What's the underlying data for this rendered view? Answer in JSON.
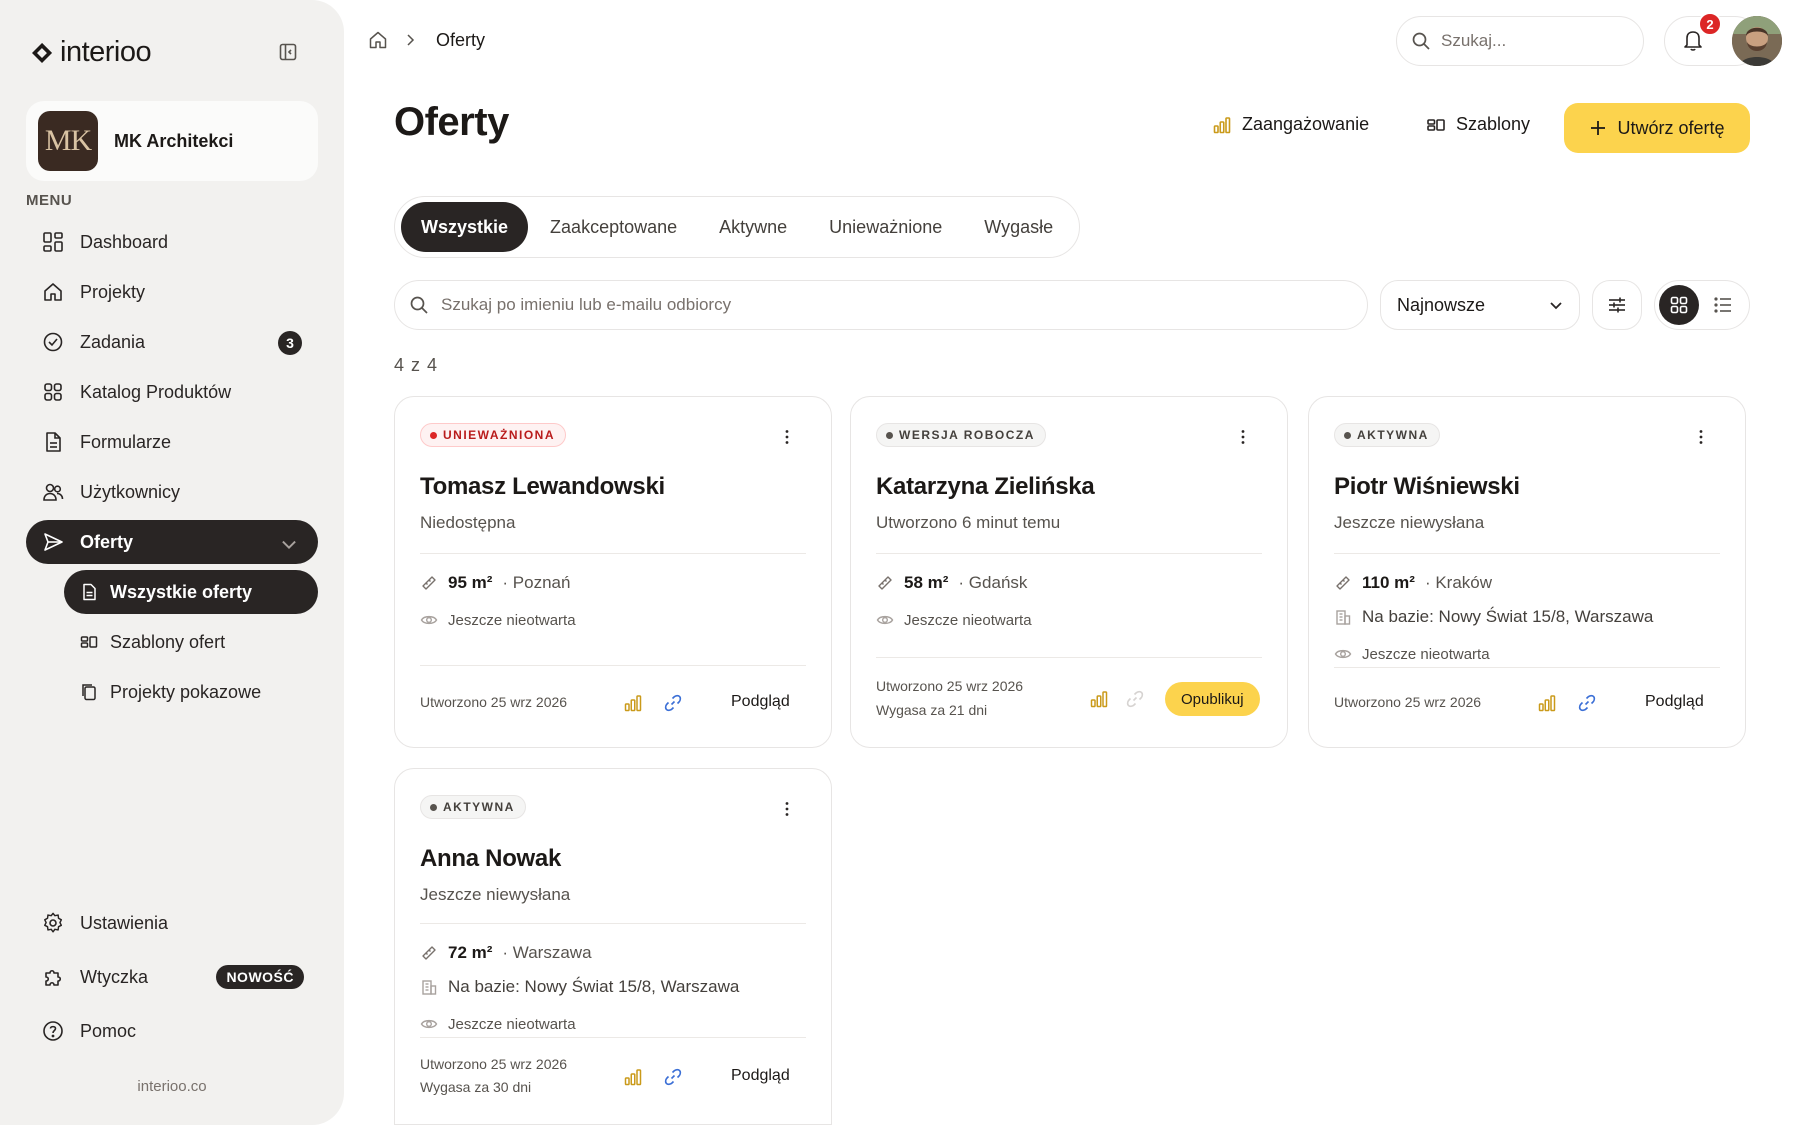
{
  "app": {
    "logo_text": "interioo",
    "footer": "interioo.co"
  },
  "org": {
    "initials": "MK",
    "name": "MK Architekci"
  },
  "sidebar": {
    "menu_label": "MENU",
    "items": [
      {
        "label": "Dashboard",
        "icon": "dashboard-icon"
      },
      {
        "label": "Projekty",
        "icon": "home-icon"
      },
      {
        "label": "Zadania",
        "icon": "check-circle-icon",
        "badge": "3"
      },
      {
        "label": "Katalog Produktów",
        "icon": "grid-icon"
      },
      {
        "label": "Formularze",
        "icon": "document-icon"
      },
      {
        "label": "Użytkownicy",
        "icon": "users-icon"
      },
      {
        "label": "Oferty",
        "icon": "send-icon",
        "active": true
      }
    ],
    "sub_items": [
      {
        "label": "Wszystkie oferty",
        "active": true
      },
      {
        "label": "Szablony ofert"
      },
      {
        "label": "Projekty pokazowe"
      }
    ],
    "bottom_items": [
      {
        "label": "Ustawienia",
        "icon": "gear-icon"
      },
      {
        "label": "Wtyczka",
        "icon": "puzzle-icon",
        "badge": "NOWOŚĆ"
      },
      {
        "label": "Pomoc",
        "icon": "help-icon"
      }
    ]
  },
  "topbar": {
    "breadcrumb": "Oferty",
    "search_placeholder": "Szukaj...",
    "notifications": "2"
  },
  "page": {
    "title": "Oferty",
    "actions": {
      "engagement": "Zaangażowanie",
      "templates": "Szablony",
      "create": "Utwórz ofertę"
    },
    "tabs": [
      "Wszystkie",
      "Zaakceptowane",
      "Aktywne",
      "Unieważnione",
      "Wygasłe"
    ],
    "active_tab": 0,
    "filter_placeholder": "Szukaj po imieniu lub e-mailu odbiorcy",
    "sort": "Najnowsze",
    "count": "4 z 4"
  },
  "cards": [
    {
      "status": "UNIEWAŻNIONA",
      "name": "Tomasz Lewandowski",
      "sub": "Niedostępna",
      "area": "95 m²",
      "city": "· Poznań",
      "seen": "Jeszcze nieotwarta",
      "created": "Utworzono 25 wrz 2026",
      "action": "Podgląd"
    },
    {
      "status": "WERSJA ROBOCZA",
      "name": "Katarzyna Zielińska",
      "sub": "Utworzono 6 minut temu",
      "area": "58 m²",
      "city": "· Gdańsk",
      "seen": "Jeszcze nieotwarta",
      "created": "Utworzono 25 wrz 2026",
      "expires": "Wygasa za 21 dni",
      "action": "Opublikuj"
    },
    {
      "status": "AKTYWNA",
      "name": "Piotr Wiśniewski",
      "sub": "Jeszcze niewysłana",
      "area": "110 m²",
      "city": "· Kraków",
      "based_on": "Na bazie: Nowy Świat 15/8, Warszawa",
      "seen": "Jeszcze nieotwarta",
      "created": "Utworzono 25 wrz 2026",
      "action": "Podgląd"
    },
    {
      "status": "AKTYWNA",
      "name": "Anna Nowak",
      "sub": "Jeszcze niewysłana",
      "area": "72 m²",
      "city": "· Warszawa",
      "based_on": "Na bazie: Nowy Świat 15/8, Warszawa",
      "seen": "Jeszcze nieotwarta",
      "created": "Utworzono 25 wrz 2026",
      "expires": "Wygasa za 30 dni",
      "action": "Podgląd"
    }
  ],
  "colors": {
    "accent": "#fcd34d",
    "dark": "#292524",
    "danger": "#dc2626",
    "sidebar_bg": "#f2f1ef"
  }
}
